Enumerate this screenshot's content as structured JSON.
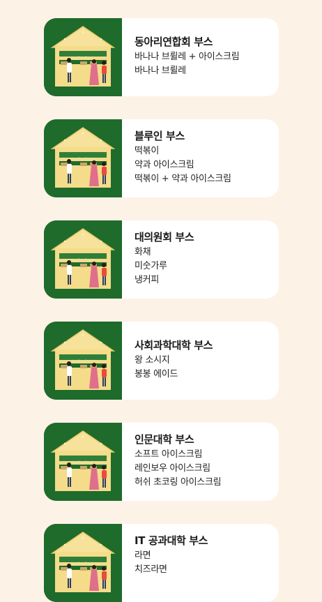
{
  "colors": {
    "background": "#FDF2E6",
    "card": "#FFFFFF",
    "thumb": "#1E6B2C",
    "tent": "#F4DC8A"
  },
  "booths": [
    {
      "title": "동아리연합회 부스",
      "items": [
        "바나나 브륄레 + 아이스크림",
        "바나나 브륄레"
      ]
    },
    {
      "title": "블루인 부스",
      "items": [
        "떡볶이",
        "약과 아이스크림",
        "떡볶이 + 약과 아이스크림"
      ]
    },
    {
      "title": "대의원회 부스",
      "items": [
        "화채",
        "미숫가루",
        "냉커피"
      ]
    },
    {
      "title": "사회과학대학 부스",
      "items": [
        "왕 소시지",
        "봉봉 에이드"
      ]
    },
    {
      "title": "인문대학 부스",
      "items": [
        "소프트 아이스크림",
        "레인보우 아이스크림",
        "허쉬 초코링 아이스크림"
      ]
    },
    {
      "title": "IT 공과대학 부스",
      "items": [
        "라면",
        "치즈라면"
      ]
    }
  ]
}
